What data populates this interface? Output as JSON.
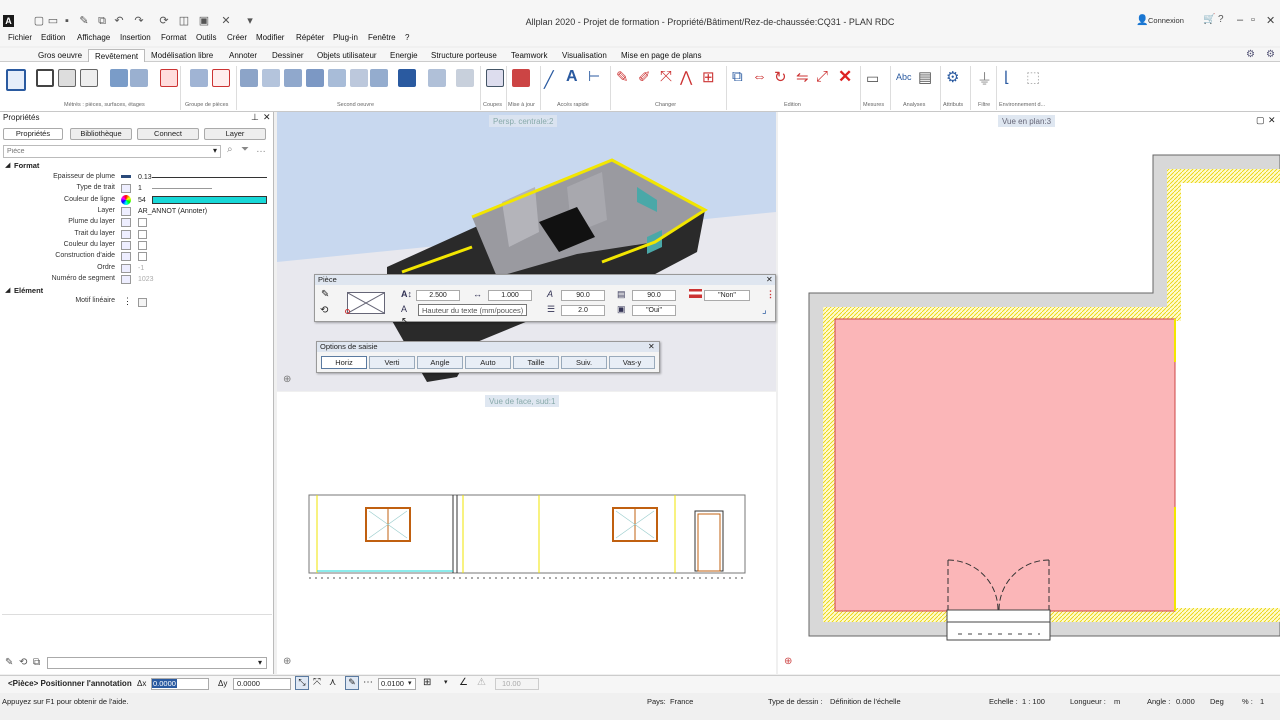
{
  "title": "Allplan 2020 - Projet de formation - Propriété/Bâtiment/Rez-de-chaussée:CQ31 - PLAN RDC",
  "connexion": "Connexion",
  "menu": [
    "Fichier",
    "Edition",
    "Affichage",
    "Insertion",
    "Format",
    "Outils",
    "Créer",
    "Modifier",
    "Répéter",
    "Plug-in",
    "Fenêtre",
    "?"
  ],
  "tabs": [
    "Gros oeuvre",
    "Revêtement",
    "Modélisation libre",
    "Annoter",
    "Dessiner",
    "Objets utilisateur",
    "Energie",
    "Structure porteuse",
    "Teamwork",
    "Visualisation",
    "Mise en page de plans"
  ],
  "ribbon_groups": [
    "Métrés : pièces, surfaces, étages",
    "Groupe de pièces",
    "Second oeuvre",
    "Coupes",
    "Mise à jour",
    "Accès rapide",
    "Changer",
    "Edition",
    "Mesures",
    "Analyses",
    "Attributs",
    "Filtre",
    "Environnement d..."
  ],
  "panel": {
    "title": "Propriétés",
    "tabs": [
      "Propriétés",
      "Bibliothèque",
      "Connect",
      "Layer"
    ],
    "search_placeholder": "Pièce",
    "format_section": "Format",
    "props": [
      {
        "label": "Epaisseur de plume",
        "value": "0.13"
      },
      {
        "label": "Type de trait",
        "value": "1"
      },
      {
        "label": "Couleur de ligne",
        "value": "54"
      },
      {
        "label": "Layer",
        "value": "AR_ANNOT (Annoter)"
      },
      {
        "label": "Plume du layer",
        "value": ""
      },
      {
        "label": "Trait du layer",
        "value": ""
      },
      {
        "label": "Couleur du layer",
        "value": ""
      },
      {
        "label": "Construction d'aide",
        "value": ""
      },
      {
        "label": "Ordre",
        "value": "-1"
      },
      {
        "label": "Numéro de segment",
        "value": "1023"
      }
    ],
    "element_section": "Elément",
    "element_props": [
      {
        "label": "Motif linéaire",
        "value": ""
      }
    ],
    "line_color": "#18d8d8"
  },
  "views": {
    "persp": "Persp. centrale:2",
    "face": "Vue de face, sud:1",
    "plan": "Vue en plan:3"
  },
  "piece_dialog": {
    "title": "Pièce",
    "text_height": "2.500",
    "text_ratio": "1.000",
    "angle1": "90.0",
    "angle2": "90.0",
    "non": "\"Non\"",
    "spacing": "2.0",
    "oui": "\"Oui\"",
    "tooltip": "Hauteur du texte (mm/pouces)"
  },
  "options_dialog": {
    "title": "Options de saisie",
    "buttons": [
      "Horiz",
      "Verti",
      "Angle",
      "Auto",
      "Taille",
      "Suiv.",
      "Vas-y"
    ]
  },
  "statusbar": {
    "prompt": "<Pièce> Positionner l'annotation",
    "dx_label": "Δx",
    "dx": "0.0000",
    "dy_label": "Δy",
    "dy": "0.0000",
    "step": "0.0100",
    "scale_field": "10.00"
  },
  "bottom": {
    "help": "Appuyez sur F1 pour obtenir de l'aide.",
    "pays_label": "Pays:",
    "pays": "France",
    "type_label": "Type de dessin :",
    "type": "Définition de l'échelle",
    "echelle_label": "Echelle :",
    "echelle": "1 : 100",
    "longueur_label": "Longueur :",
    "longueur": "m",
    "angle_label": "Angle :",
    "angle": "0.000",
    "angle_unit": "Deg",
    "pct_label": "% :",
    "pct": "1"
  }
}
